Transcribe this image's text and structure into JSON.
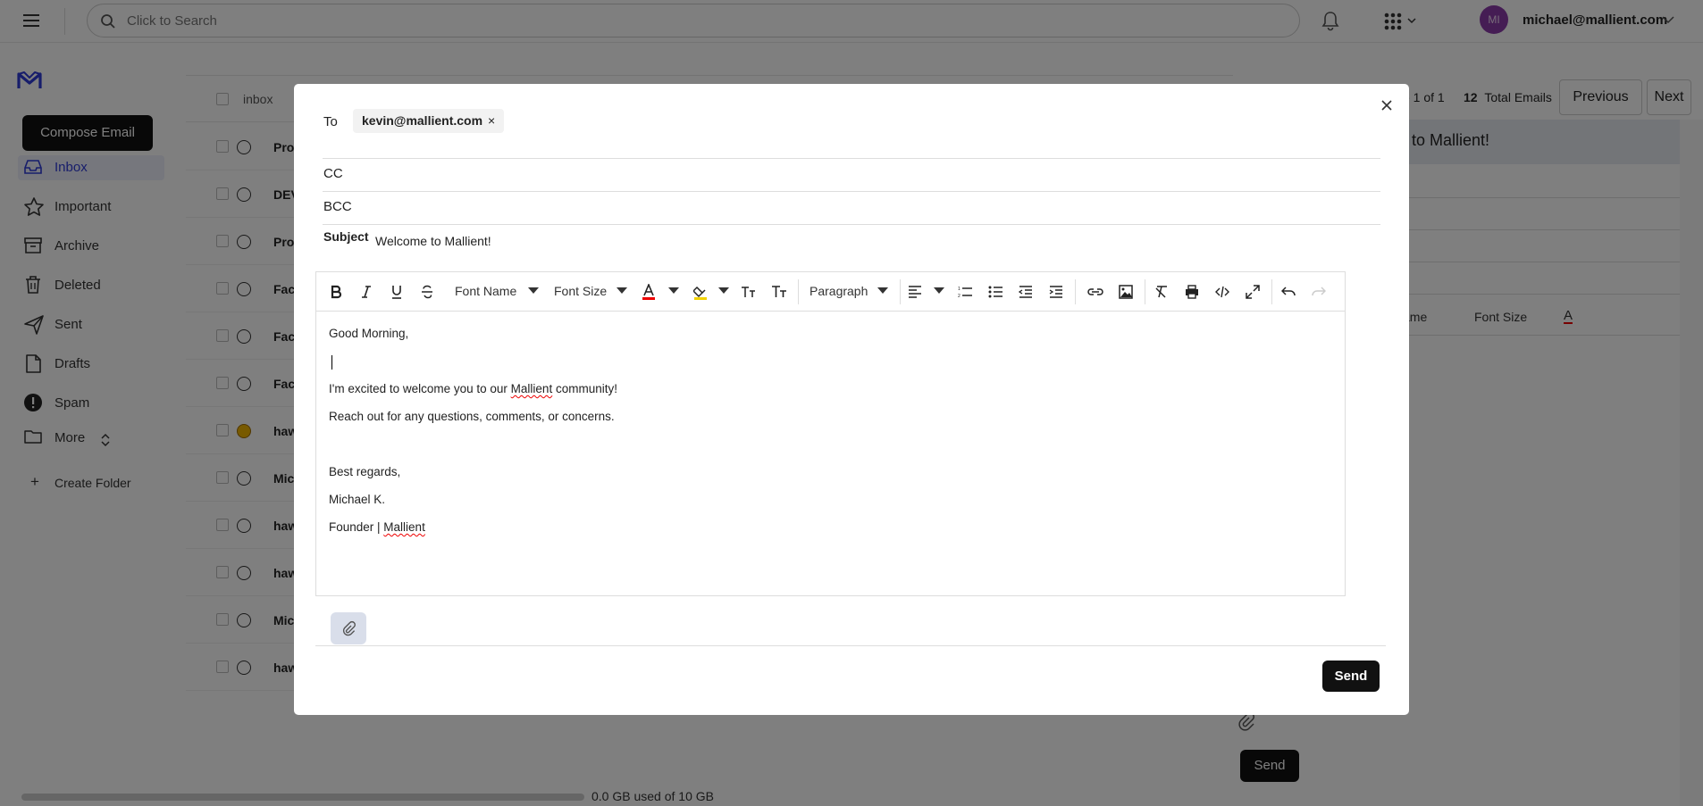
{
  "topbar": {
    "search_placeholder": "Click to Search",
    "avatar_initials": "MI",
    "user_email": "michael@mallient.com"
  },
  "sidebar": {
    "compose_label": "Compose Email",
    "items": [
      {
        "label": "Inbox",
        "icon": "inbox-icon"
      },
      {
        "label": "Important",
        "icon": "star-icon"
      },
      {
        "label": "Archive",
        "icon": "archive-icon"
      },
      {
        "label": "Deleted",
        "icon": "trash-icon"
      },
      {
        "label": "Sent",
        "icon": "send-icon"
      },
      {
        "label": "Drafts",
        "icon": "draft-icon"
      },
      {
        "label": "Spam",
        "icon": "alert-icon"
      },
      {
        "label": "More",
        "icon": "folder-icon"
      }
    ],
    "create_folder": "Create Folder"
  },
  "list": {
    "folder_label": "inbox",
    "senders": [
      "Pro",
      "DEV",
      "Pro",
      "Fac",
      "Fac",
      "Fac",
      "haw",
      "Mic",
      "haw",
      "haw",
      "Mic",
      "haw"
    ]
  },
  "pagination": {
    "page_text": "e 1 of 1",
    "total_count": "12",
    "total_label": "Total Emails",
    "prev_label": "Previous",
    "next_label": "Next"
  },
  "reading_pane": {
    "subject_partial": "to Mallient!",
    "font_name_partial": "ame",
    "font_size": "Font Size",
    "send_label": "Send"
  },
  "storage": {
    "text": "0.0 GB used of 10 GB"
  },
  "compose": {
    "to_label": "To",
    "to_chip": "kevin@mallient.com",
    "chip_remove": "×",
    "cc_label": "CC",
    "bcc_label": "BCC",
    "subject_label": "Subject",
    "subject_value": "Welcome to Mallient!",
    "toolbar": {
      "font_name": "Font Name",
      "font_size": "Font Size",
      "paragraph": "Paragraph"
    },
    "body": {
      "line1": "Good Morning,",
      "line2a": "I'm excited to welcome you to our ",
      "line2b": "Mallient",
      "line2c": " community!",
      "line3": "Reach out for any questions, comments, or concerns.",
      "line4": "Best regards,",
      "line5": "Michael K.",
      "line6a": "Founder | ",
      "line6b": "Mallient"
    },
    "send_label": "Send",
    "close": "×"
  },
  "colors": {
    "accent": "#2f3bd6",
    "send_bg": "#111111",
    "avatar": "#8a3aa8"
  }
}
